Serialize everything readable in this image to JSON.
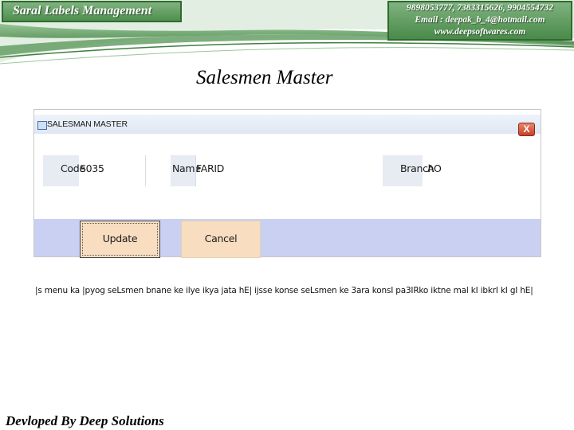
{
  "header": {
    "brand": "Saral Labels Management",
    "phones": "9898053777, 7383315626, 9904554732",
    "email": "Email : deepak_b_4@hotmail.com",
    "website": "www.deepsoftwares.com",
    "accent_color": "#4f8f4f"
  },
  "page_title": "Salesmen Master",
  "window": {
    "title": "SALESMAN MASTER",
    "close_label": "X",
    "fields": [
      {
        "label": "Code",
        "value": "S035"
      },
      {
        "label": "Name",
        "value": "FARID"
      },
      {
        "label": "Branch",
        "value": "AO"
      }
    ],
    "buttons": {
      "update": "Update",
      "cancel": "Cancel"
    }
  },
  "description": "|s menu ka |pyog seLsmen bnane ke ilye ikya jata hE| ijsse konse seLsmen ke 3ara konsI pa3IRko iktne mal kI ibkrI kI gI hE|",
  "footer": "Devloped By Deep Solutions"
}
